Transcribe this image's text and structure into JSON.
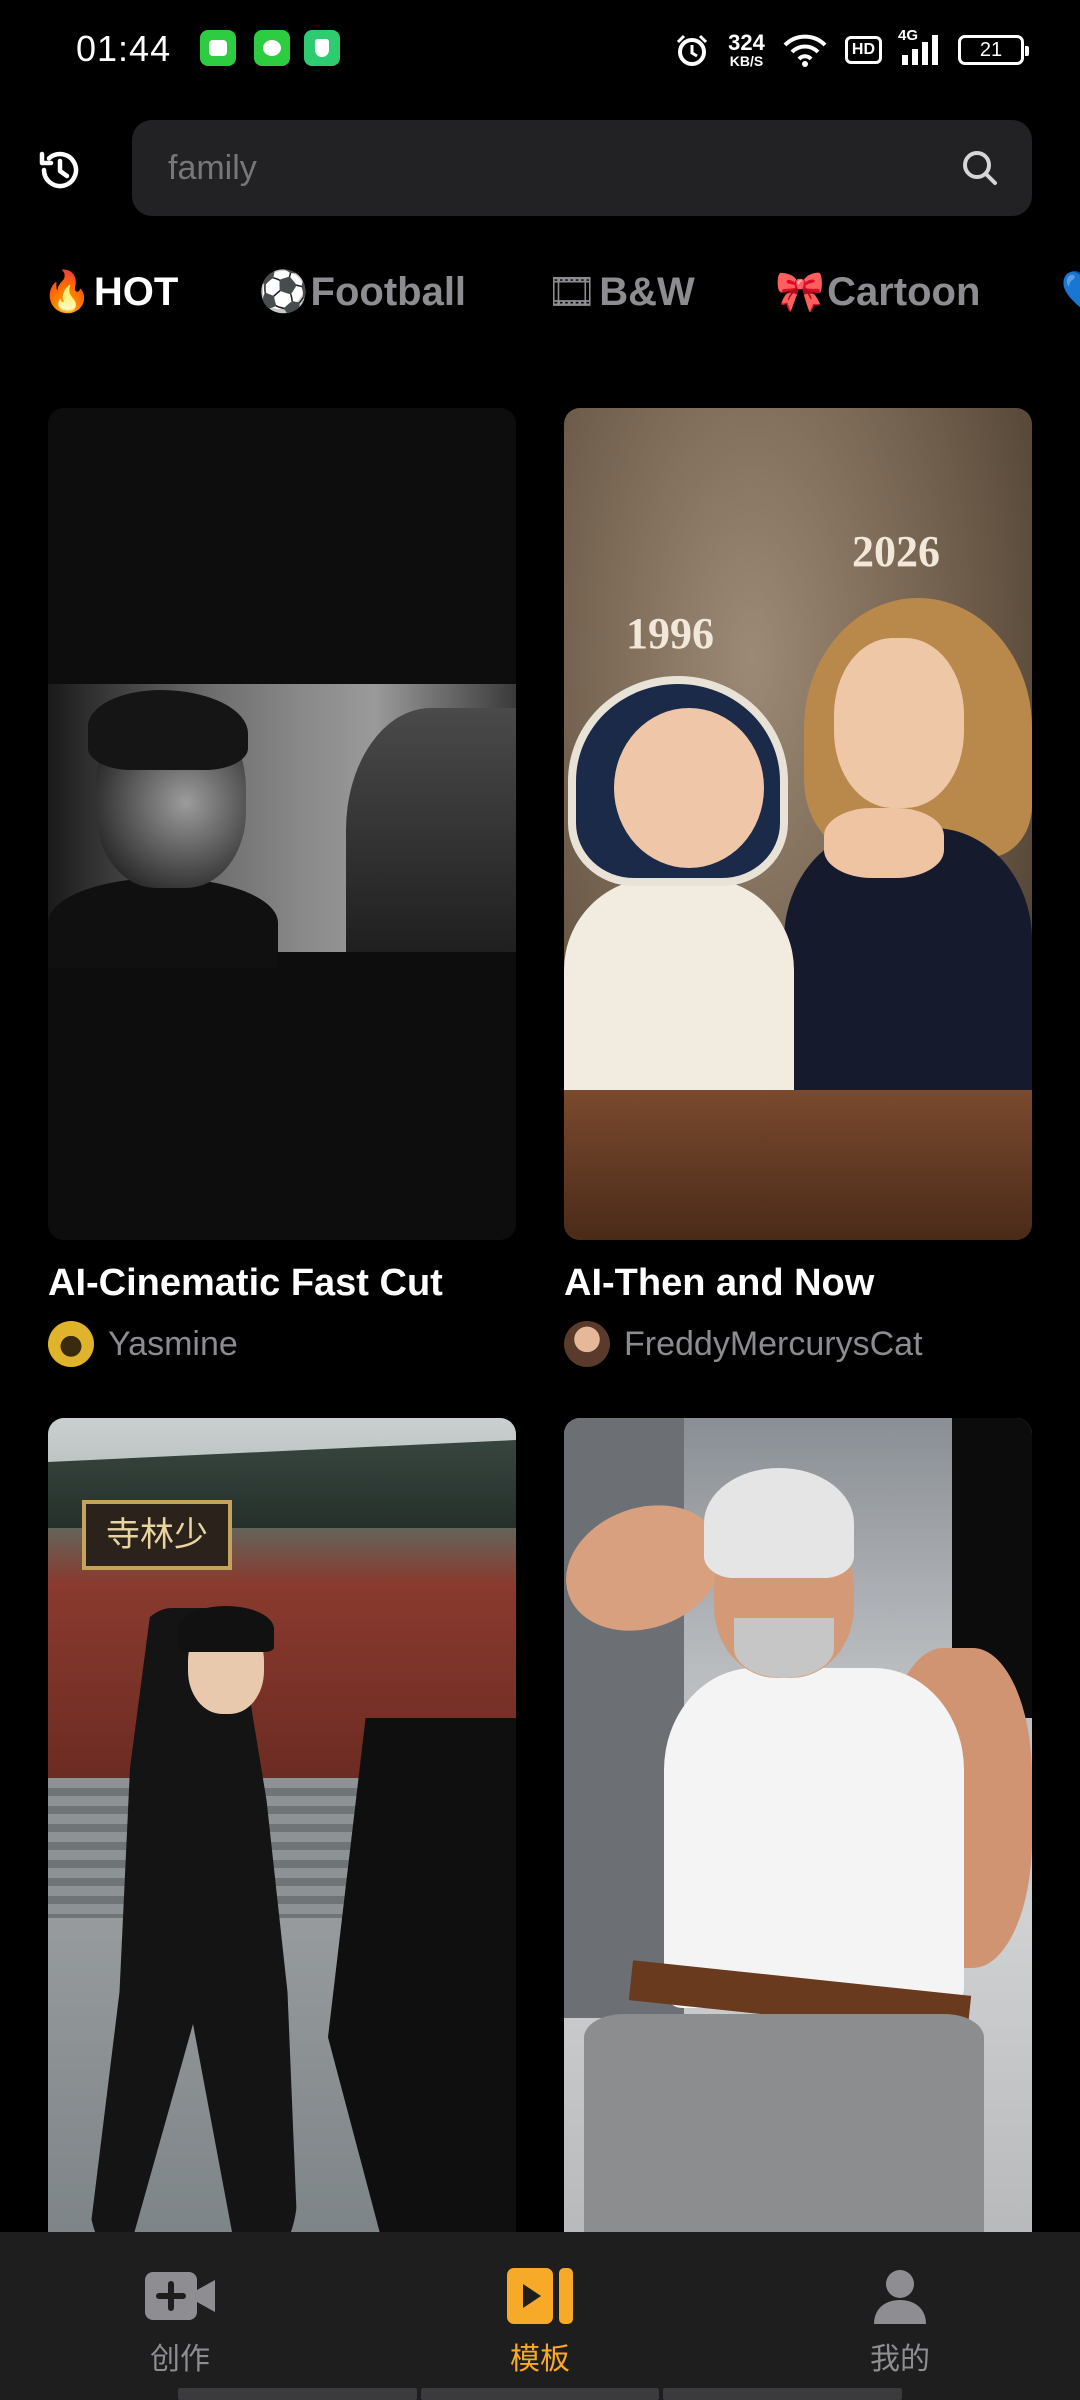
{
  "status_bar": {
    "time": "01:44",
    "net_speed_value": "324",
    "net_speed_unit": "KB/S",
    "hd_label": "HD",
    "network_label": "4G",
    "battery_level": "21"
  },
  "search": {
    "placeholder": "family"
  },
  "tabs": [
    {
      "emoji": "🔥",
      "label": "HOT",
      "active": true
    },
    {
      "emoji": "⚽",
      "label": "Football",
      "active": false
    },
    {
      "emoji": "🎞",
      "label": "B&W",
      "active": false
    },
    {
      "emoji": "🎀",
      "label": "Cartoon",
      "active": false
    },
    {
      "emoji": "💙",
      "label": "",
      "active": false
    }
  ],
  "cards": [
    {
      "title": "AI-Cinematic Fast Cut",
      "author": "Yasmine"
    },
    {
      "title": "AI-Then and Now",
      "author": "FreddyMercurysCat",
      "year_left": "1996",
      "year_right": "2026"
    },
    {
      "temple_sign": "寺林少"
    },
    {}
  ],
  "bottom_nav": {
    "items": [
      {
        "label": "创作",
        "icon": "video-add-icon",
        "active": false
      },
      {
        "label": "模板",
        "icon": "template-icon",
        "active": true
      },
      {
        "label": "我的",
        "icon": "profile-icon",
        "active": false
      }
    ]
  },
  "colors": {
    "accent": "#f7a928",
    "background": "#000000",
    "search_bg": "#222224",
    "nav_bg": "#1e1e1f"
  }
}
